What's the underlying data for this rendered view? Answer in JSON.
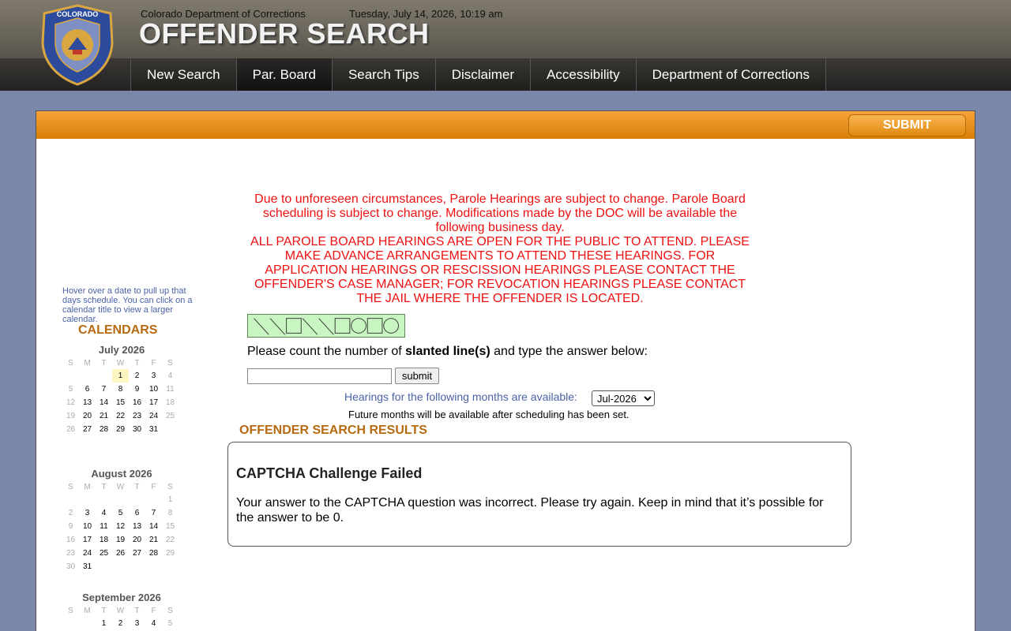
{
  "header": {
    "department": "Colorado Department of Corrections",
    "datetime": "Tuesday, July 14, 2026, 10:19 am",
    "title": "OFFENDER SEARCH",
    "seal_text": "COLORADO DEPARTMENT OF CORRECTIONS"
  },
  "nav": {
    "items": [
      {
        "label": "New Search"
      },
      {
        "label": "Par. Board"
      },
      {
        "label": "Search Tips"
      },
      {
        "label": "Disclaimer"
      },
      {
        "label": "Accessibility"
      },
      {
        "label": "Department of Corrections"
      }
    ],
    "active": "Par. Board"
  },
  "toolbar": {
    "submit_label": "SUBMIT"
  },
  "sidebar": {
    "hint": "Hover over a date to pull up that days schedule. You can click on a calendar title to view a larger calendar.",
    "heading": "CALENDARS",
    "weekdays": [
      "S",
      "M",
      "T",
      "W",
      "T",
      "F",
      "S"
    ],
    "calendars": [
      {
        "title": "July 2026",
        "first_weekday": 3,
        "days": 31,
        "highlight": 1
      },
      {
        "title": "August 2026",
        "first_weekday": 6,
        "days": 31
      },
      {
        "title": "September 2026",
        "first_weekday": 2,
        "days": 5
      }
    ]
  },
  "notice": {
    "line1": "Due to unforeseen circumstances, Parole Hearings are subject to change. Parole Board scheduling is subject to change. Modifications made by the DOC will be available the following business day.",
    "line2": "ALL PAROLE BOARD HEARINGS ARE OPEN FOR THE PUBLIC TO ATTEND. PLEASE MAKE ADVANCE ARRANGEMENTS TO ATTEND THESE HEARINGS. FOR APPLICATION HEARINGS OR RESCISSION HEARINGS PLEASE CONTACT THE OFFENDER'S CASE MANAGER; FOR REVOCATION HEARINGS PLEASE CONTACT THE JAIL WHERE THE OFFENDER IS LOCATED."
  },
  "captcha": {
    "shapes": [
      "slash",
      "slash",
      "square",
      "slash",
      "slash",
      "square",
      "circle",
      "square",
      "circle"
    ],
    "question_prefix": "Please count the number of ",
    "question_bold": "slanted line(s)",
    "question_suffix": " and type the answer below:",
    "input_value": "",
    "button_label": "submit"
  },
  "hearings": {
    "label": "Hearings for the following months are available:",
    "selected_month": "Jul-2026",
    "future_note": "Future months will be available after scheduling has been set."
  },
  "results": {
    "heading": "OFFENDER SEARCH RESULTS",
    "title": "CAPTCHA Challenge Failed",
    "message": "Your answer to the CAPTCHA question was incorrect. Please try again. Keep in mind that it’s possible for the answer to be 0."
  },
  "colors": {
    "accent_orange": "#e08a10",
    "notice_red": "#ee1111",
    "link_blue": "#4a63a8",
    "page_bg": "#7a86aa"
  }
}
